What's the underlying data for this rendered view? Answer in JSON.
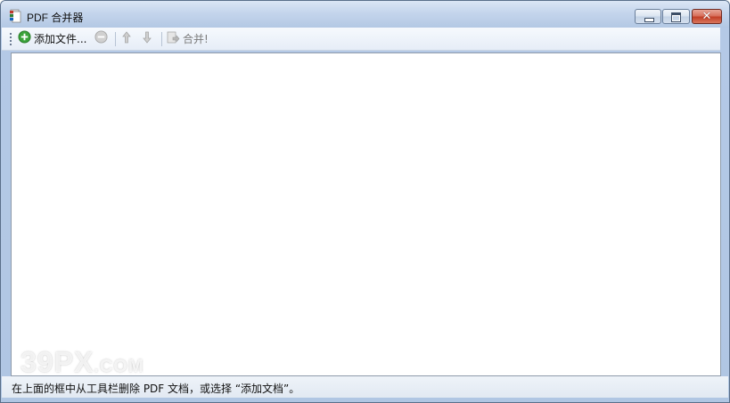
{
  "window": {
    "title": "PDF 合并器",
    "close_glyph": "✕"
  },
  "toolbar": {
    "add_label": "添加文件...",
    "add_icon": "add-circle-icon",
    "remove_icon": "remove-circle-icon",
    "up_icon": "arrow-up-icon",
    "down_icon": "arrow-down-icon",
    "merge_label": "合并!",
    "merge_icon": "merge-document-icon"
  },
  "status": {
    "text": "在上面的框中从工具栏删除 PDF 文档，或选择 “添加文档”。"
  },
  "watermark": {
    "text": "39PX",
    "suffix": ".COM"
  },
  "colors": {
    "add_green": "#3aa33a",
    "disabled_gray": "#9a9a9a",
    "close_red": "#c23f27"
  }
}
